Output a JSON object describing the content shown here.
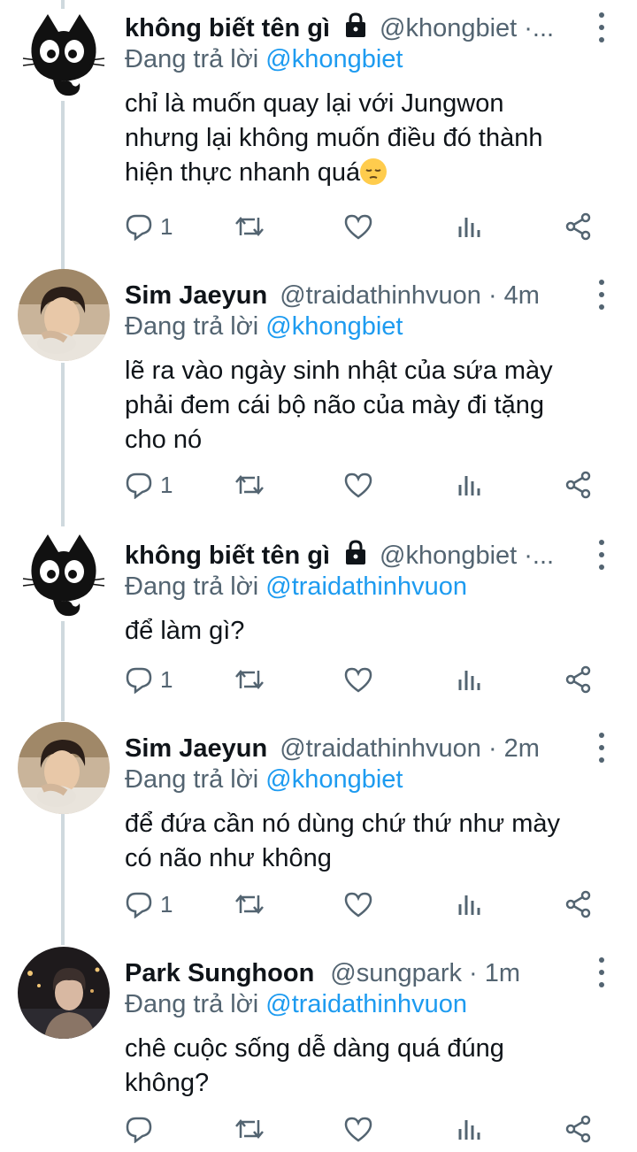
{
  "tweets": [
    {
      "name": "không biết tên gì",
      "locked": true,
      "handle": "@khongbiet ·...",
      "time": "",
      "replying_prefix": "Đang trả lời",
      "replying_to": "@khongbiet",
      "text_lines": [
        "chỉ là muốn quay lại với Jungwon",
        "nhưng lại không muốn điều đó thành",
        "hiện thực nhanh quá"
      ],
      "emoji": "pensive-face-emoji",
      "reply_count": "1",
      "avatar": "black-cat-avatar"
    },
    {
      "name": "Sim Jaeyun",
      "locked": false,
      "handle": "@traidathinhvuon",
      "time": "4m",
      "replying_prefix": "Đang trả lời",
      "replying_to": "@khongbiet",
      "text_lines": [
        "lẽ ra vào ngày sinh nhật của sứa mày",
        "phải đem cái bộ não của mày đi tặng",
        "cho nó"
      ],
      "reply_count": "1",
      "avatar": "photo-avatar-jaeyun"
    },
    {
      "name": "không biết tên gì",
      "locked": true,
      "handle": "@khongbiet ·...",
      "time": "",
      "replying_prefix": "Đang trả lời",
      "replying_to": "@traidathinhvuon",
      "text_lines": [
        "để làm gì?"
      ],
      "reply_count": "1",
      "avatar": "black-cat-avatar"
    },
    {
      "name": "Sim Jaeyun",
      "locked": false,
      "handle": "@traidathinhvuon",
      "time": "2m",
      "replying_prefix": "Đang trả lời",
      "replying_to": "@khongbiet",
      "text_lines": [
        "để đứa cần nó dùng chứ thứ như mày",
        "có não như không"
      ],
      "reply_count": "1",
      "avatar": "photo-avatar-jaeyun"
    },
    {
      "name": "Park Sunghoon",
      "locked": false,
      "handle": "@sungpark",
      "time": "1m",
      "replying_prefix": "Đang trả lời",
      "replying_to": "@traidathinhvuon",
      "text_lines": [
        "chê cuộc sống dễ dàng quá đúng",
        "không?"
      ],
      "reply_count": "",
      "avatar": "photo-avatar-sunghoon"
    }
  ],
  "action_icons": [
    "reply-icon",
    "retweet-icon",
    "like-icon",
    "analytics-icon",
    "share-icon"
  ],
  "colors": {
    "link": "#1d9bf0",
    "secondary": "#536471",
    "thread_line": "#cfd9de"
  }
}
